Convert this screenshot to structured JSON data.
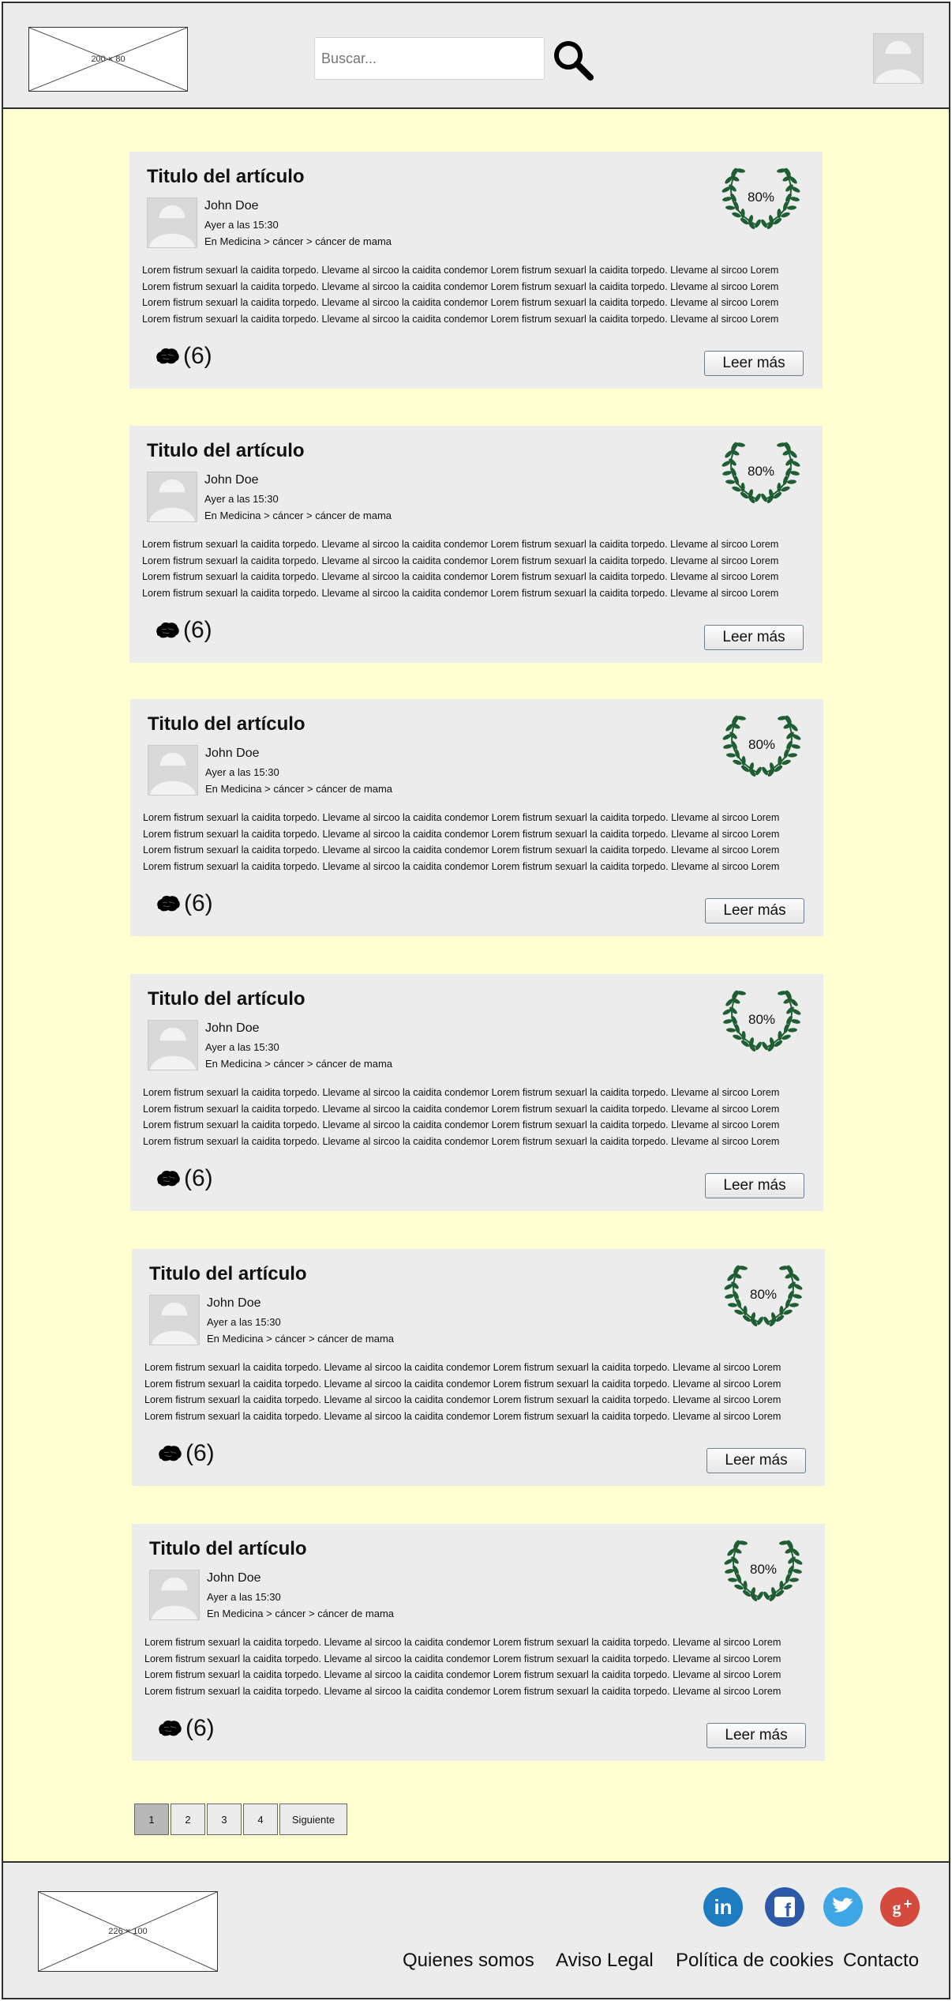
{
  "header": {
    "logo_placeholder": "200 × 80",
    "search_placeholder": "Buscar..."
  },
  "articles": [
    {
      "title": "Titulo del artículo",
      "author": "John Doe",
      "time": "Ayer a las 15:30",
      "path": "En Medicina > cáncer > cáncer de mama",
      "rating": "80%",
      "lines": [
        "Lorem fistrum sexuarl la caidita torpedo. Llevame al sircoo la caidita condemor Lorem fistrum sexuarl la caidita torpedo. Llevame al sircoo Lorem",
        "Lorem fistrum sexuarl la caidita torpedo. Llevame al sircoo la caidita condemor Lorem fistrum sexuarl la caidita torpedo. Llevame al sircoo Lorem",
        "Lorem fistrum sexuarl la caidita torpedo. Llevame al sircoo la caidita condemor Lorem fistrum sexuarl la caidita torpedo. Llevame al sircoo Lorem",
        "Lorem fistrum sexuarl la caidita torpedo. Llevame al sircoo la caidita condemor Lorem fistrum sexuarl la caidita torpedo. Llevame al sircoo Lorem"
      ],
      "comments": "(6)",
      "more_label": "Leer más"
    },
    {
      "title": "Titulo del artículo",
      "author": "John Doe",
      "time": "Ayer a las 15:30",
      "path": "En Medicina > cáncer > cáncer de mama",
      "rating": "80%",
      "lines": [
        "Lorem fistrum sexuarl la caidita torpedo. Llevame al sircoo la caidita condemor Lorem fistrum sexuarl la caidita torpedo. Llevame al sircoo Lorem",
        "Lorem fistrum sexuarl la caidita torpedo. Llevame al sircoo la caidita condemor Lorem fistrum sexuarl la caidita torpedo. Llevame al sircoo Lorem",
        "Lorem fistrum sexuarl la caidita torpedo. Llevame al sircoo la caidita condemor Lorem fistrum sexuarl la caidita torpedo. Llevame al sircoo Lorem",
        "Lorem fistrum sexuarl la caidita torpedo. Llevame al sircoo la caidita condemor Lorem fistrum sexuarl la caidita torpedo. Llevame al sircoo Lorem"
      ],
      "comments": "(6)",
      "more_label": "Leer más"
    },
    {
      "title": "Titulo del artículo",
      "author": "John Doe",
      "time": "Ayer a las 15:30",
      "path": "En Medicina > cáncer > cáncer de mama",
      "rating": "80%",
      "lines": [
        "Lorem fistrum sexuarl la caidita torpedo. Llevame al sircoo la caidita condemor Lorem fistrum sexuarl la caidita torpedo. Llevame al sircoo Lorem",
        "Lorem fistrum sexuarl la caidita torpedo. Llevame al sircoo la caidita condemor Lorem fistrum sexuarl la caidita torpedo. Llevame al sircoo Lorem",
        "Lorem fistrum sexuarl la caidita torpedo. Llevame al sircoo la caidita condemor Lorem fistrum sexuarl la caidita torpedo. Llevame al sircoo Lorem",
        "Lorem fistrum sexuarl la caidita torpedo. Llevame al sircoo la caidita condemor Lorem fistrum sexuarl la caidita torpedo. Llevame al sircoo Lorem"
      ],
      "comments": "(6)",
      "more_label": "Leer más"
    },
    {
      "title": "Titulo del artículo",
      "author": "John Doe",
      "time": "Ayer a las 15:30",
      "path": "En Medicina > cáncer > cáncer de mama",
      "rating": "80%",
      "lines": [
        "Lorem fistrum sexuarl la caidita torpedo. Llevame al sircoo la caidita condemor Lorem fistrum sexuarl la caidita torpedo. Llevame al sircoo Lorem",
        "Lorem fistrum sexuarl la caidita torpedo. Llevame al sircoo la caidita condemor Lorem fistrum sexuarl la caidita torpedo. Llevame al sircoo Lorem",
        "Lorem fistrum sexuarl la caidita torpedo. Llevame al sircoo la caidita condemor Lorem fistrum sexuarl la caidita torpedo. Llevame al sircoo Lorem",
        "Lorem fistrum sexuarl la caidita torpedo. Llevame al sircoo la caidita condemor Lorem fistrum sexuarl la caidita torpedo. Llevame al sircoo Lorem"
      ],
      "comments": "(6)",
      "more_label": "Leer más"
    },
    {
      "title": "Titulo del artículo",
      "author": "John Doe",
      "time": "Ayer a las 15:30",
      "path": "En Medicina > cáncer > cáncer de mama",
      "rating": "80%",
      "lines": [
        "Lorem fistrum sexuarl la caidita torpedo. Llevame al sircoo la caidita condemor Lorem fistrum sexuarl la caidita torpedo. Llevame al sircoo Lorem",
        "Lorem fistrum sexuarl la caidita torpedo. Llevame al sircoo la caidita condemor Lorem fistrum sexuarl la caidita torpedo. Llevame al sircoo Lorem",
        "Lorem fistrum sexuarl la caidita torpedo. Llevame al sircoo la caidita condemor Lorem fistrum sexuarl la caidita torpedo. Llevame al sircoo Lorem",
        "Lorem fistrum sexuarl la caidita torpedo. Llevame al sircoo la caidita condemor Lorem fistrum sexuarl la caidita torpedo. Llevame al sircoo Lorem"
      ],
      "comments": "(6)",
      "more_label": "Leer más"
    },
    {
      "title": "Titulo del artículo",
      "author": "John Doe",
      "time": "Ayer a las 15:30",
      "path": "En Medicina > cáncer > cáncer de mama",
      "rating": "80%",
      "lines": [
        "Lorem fistrum sexuarl la caidita torpedo. Llevame al sircoo la caidita condemor Lorem fistrum sexuarl la caidita torpedo. Llevame al sircoo Lorem",
        "Lorem fistrum sexuarl la caidita torpedo. Llevame al sircoo la caidita condemor Lorem fistrum sexuarl la caidita torpedo. Llevame al sircoo Lorem",
        "Lorem fistrum sexuarl la caidita torpedo. Llevame al sircoo la caidita condemor Lorem fistrum sexuarl la caidita torpedo. Llevame al sircoo Lorem",
        "Lorem fistrum sexuarl la caidita torpedo. Llevame al sircoo la caidita condemor Lorem fistrum sexuarl la caidita torpedo. Llevame al sircoo Lorem"
      ],
      "comments": "(6)",
      "more_label": "Leer más"
    }
  ],
  "pagination": {
    "pages": [
      "1",
      "2",
      "3",
      "4"
    ],
    "current": "1",
    "next_label": "Siguiente"
  },
  "footer": {
    "logo_placeholder": "226 × 100",
    "social": [
      {
        "name": "linkedin",
        "icon": "linkedin-icon",
        "color": "#1d7bbf"
      },
      {
        "name": "facebook",
        "icon": "facebook-icon",
        "color": "#2c5aa8"
      },
      {
        "name": "twitter",
        "icon": "twitter-icon",
        "color": "#3fa6e6"
      },
      {
        "name": "google-plus",
        "icon": "google-plus-icon",
        "color": "#d44a3c"
      }
    ],
    "links": [
      "Quienes somos",
      "Aviso Legal",
      "Política de cookies",
      "Contacto"
    ]
  },
  "colors": {
    "page_background": "#ffffd2",
    "panel_gray": "#ececec",
    "laurel_green": "#1e5e32"
  }
}
